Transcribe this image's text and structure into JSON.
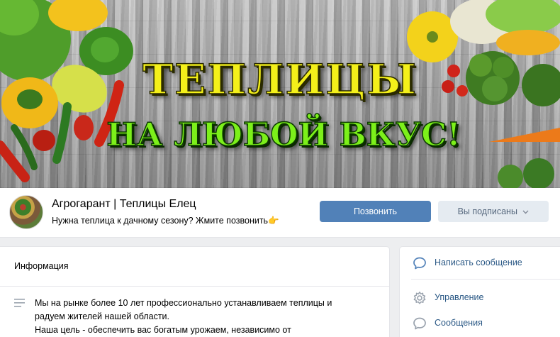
{
  "cover": {
    "line1": "ТЕПЛИЦЫ",
    "line2": "НА ЛЮБОЙ ВКУС!"
  },
  "group": {
    "title": "Агрогарант | Теплицы Елец",
    "status": "Нужна теплица к дачному сезону? Жмите позвонить👉"
  },
  "actions": {
    "call_label": "Позвонить",
    "subscribed_label": "Вы подписаны"
  },
  "info": {
    "heading": "Информация",
    "description_lines": [
      "Мы на рынке более 10 лет профессионально устанавливаем теплицы и",
      "радуем жителей нашей области.",
      "Наша цель - обеспечить вас богатым урожаем, независимо от"
    ]
  },
  "side_menu": {
    "items": [
      {
        "label": "Написать сообщение",
        "icon": "message-icon"
      },
      {
        "label": "Управление",
        "icon": "gear-icon"
      },
      {
        "label": "Сообщения",
        "icon": "chat-bubble-icon"
      }
    ]
  },
  "colors": {
    "accent": "#5181b8",
    "link": "#2a5885",
    "secondary_button": "#e5ebf1",
    "page_background": "#edeef0"
  }
}
